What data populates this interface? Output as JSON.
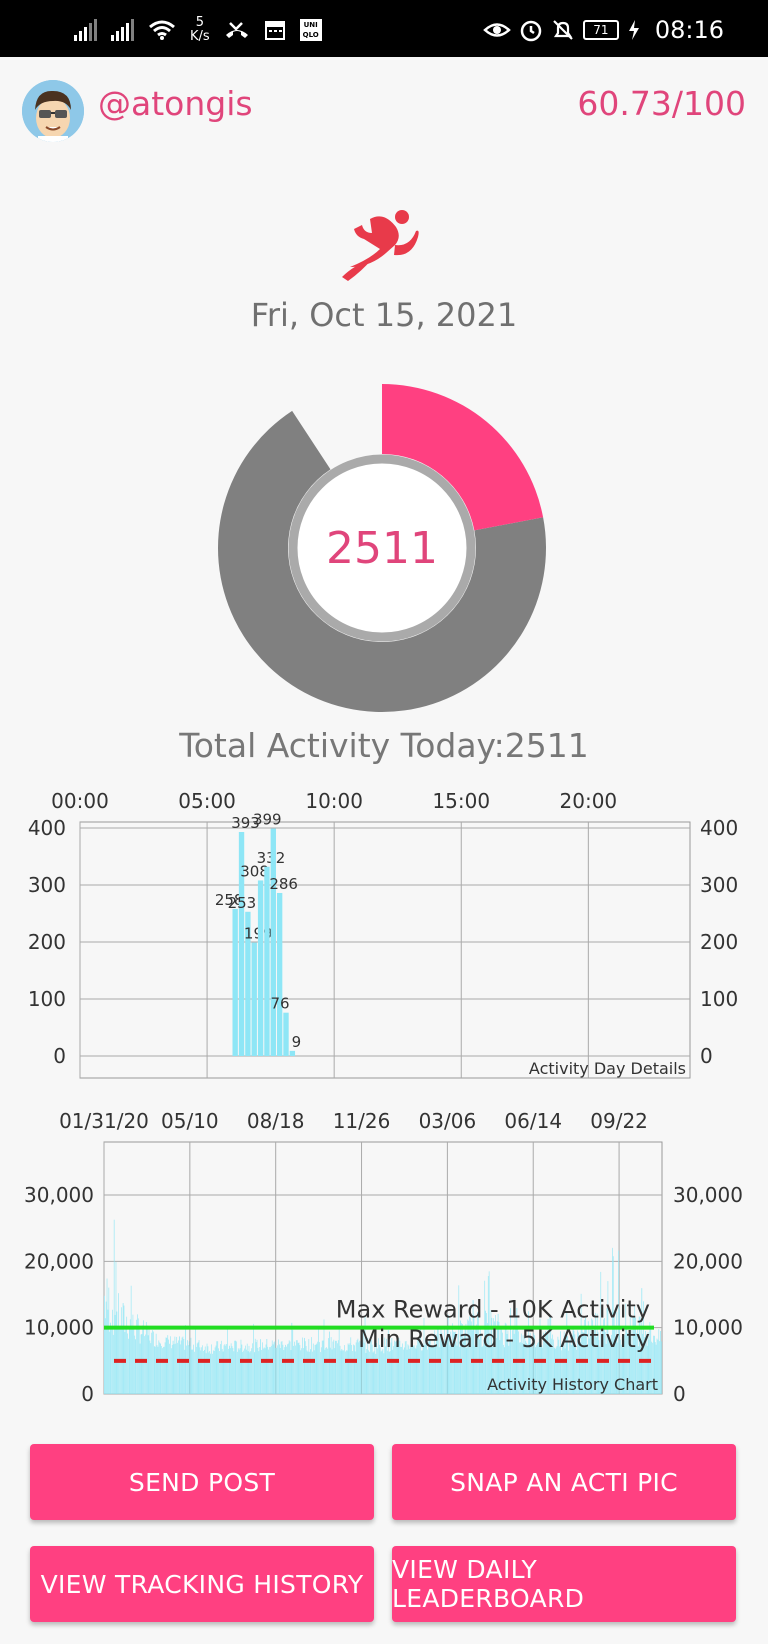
{
  "status_bar": {
    "net_speed_value": "5",
    "net_speed_unit": "K/s",
    "uniqlo_top": "UNI",
    "uniqlo_bottom": "QLO",
    "battery": "71",
    "time": "08:16"
  },
  "header": {
    "username": "@atongis",
    "score": "60.73/100"
  },
  "date": "Fri, Oct 15, 2021",
  "activity_ring": {
    "value": "2511",
    "progress_fraction": 0.22,
    "colors": {
      "progress": "#ff4081",
      "remaining": "#808080"
    }
  },
  "total_activity": "Total Activity Today:2511",
  "chart_data": [
    {
      "type": "bar",
      "title": "Activity Day Details",
      "x_ticks": [
        "00:00",
        "05:00",
        "10:00",
        "15:00",
        "20:00"
      ],
      "x_unit_hours": [
        0,
        5,
        10,
        15,
        20
      ],
      "x_range_hours": [
        0,
        24
      ],
      "ylim": [
        0,
        400
      ],
      "y_ticks": [
        "0",
        "100",
        "200",
        "300",
        "400"
      ],
      "bars": [
        {
          "hour": 6.0,
          "value": 258,
          "label": "258"
        },
        {
          "hour": 6.25,
          "value": 393,
          "label": "393"
        },
        {
          "hour": 6.5,
          "value": 253,
          "label": "253"
        },
        {
          "hour": 6.75,
          "value": 199,
          "label": "199"
        },
        {
          "hour": 7.0,
          "value": 308,
          "label": "308"
        },
        {
          "hour": 7.25,
          "value": 332,
          "label": "332"
        },
        {
          "hour": 7.5,
          "value": 399,
          "label": "399"
        },
        {
          "hour": 7.75,
          "value": 286,
          "label": "286"
        },
        {
          "hour": 8.0,
          "value": 76,
          "label": "76"
        },
        {
          "hour": 8.25,
          "value": 9,
          "label": "9"
        }
      ],
      "color": "#8ee6f6",
      "grid": true
    },
    {
      "type": "bar",
      "title": "Activity History Chart",
      "x_ticks": [
        "01/31/20",
        "05/10",
        "08/18",
        "11/26",
        "03/06",
        "06/14",
        "09/22"
      ],
      "ylim": [
        0,
        38000
      ],
      "y_ticks": [
        "0",
        "10,000",
        "20,000",
        "30,000"
      ],
      "y_tick_values": [
        0,
        10000,
        20000,
        30000
      ],
      "reference_lines": [
        {
          "name": "Max Reward - 10K Activity",
          "value": 10000,
          "color": "#22dd22",
          "style": "solid"
        },
        {
          "name": "Min Reward - 5K Activity",
          "value": 5000,
          "color": "#dd2222",
          "style": "dashed"
        }
      ],
      "history_profile": [
        [
          0,
          9000,
          32000
        ],
        [
          20,
          8000,
          22000
        ],
        [
          60,
          7000,
          12000
        ],
        [
          120,
          6000,
          10500
        ],
        [
          200,
          6500,
          11000
        ],
        [
          300,
          6000,
          12000
        ],
        [
          350,
          6500,
          11000
        ],
        [
          430,
          7000,
          21000
        ],
        [
          470,
          7000,
          13000
        ],
        [
          520,
          6500,
          13500
        ],
        [
          560,
          7000,
          22000
        ],
        [
          590,
          7000,
          23000
        ],
        [
          625,
          7000,
          12000
        ]
      ],
      "days": 625,
      "color": "#8ee6f6",
      "grid": true
    }
  ],
  "buttons": {
    "send_post": "SEND POST",
    "snap_pic": "SNAP AN ACTI PIC",
    "tracking_history": "VIEW TRACKING HISTORY",
    "daily_leaderboard": "VIEW DAILY LEADERBOARD"
  },
  "icons": {
    "runner": "runner-icon",
    "avatar": "avatar-image"
  }
}
